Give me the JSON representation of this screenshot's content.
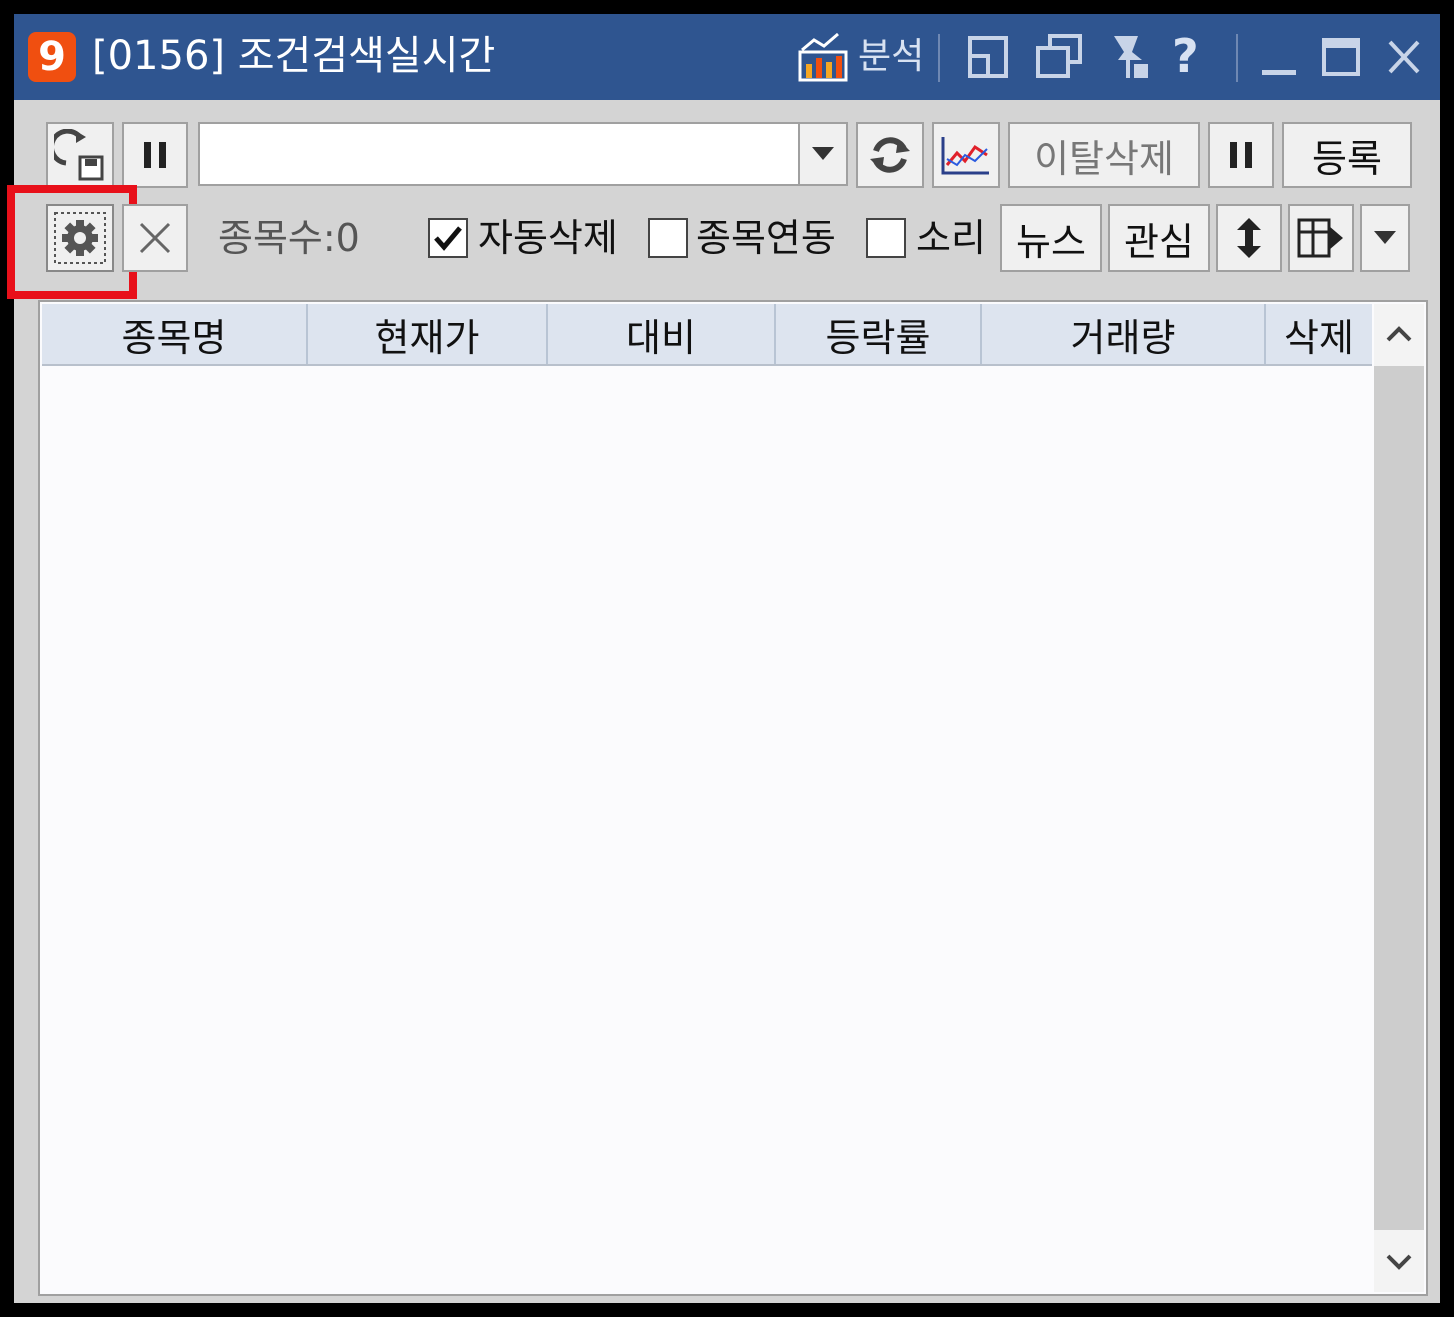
{
  "window": {
    "logo": "9",
    "title": "[0156] 조건검색실시간",
    "analysis_label": "분석",
    "help": "?",
    "icons": [
      "chart-analysis-icon",
      "restore-small-icon",
      "cascade-icon",
      "pin-icon",
      "help-icon",
      "minimize-icon",
      "maximize-icon",
      "close-icon"
    ]
  },
  "toolbar": {
    "condition_value": "",
    "exit_delete_label": "이탈삭제",
    "register_label": "등록"
  },
  "toolbar2": {
    "count_label": "종목수:0",
    "auto_delete_label": "자동삭제",
    "auto_delete_checked": true,
    "link_label": "종목연동",
    "link_checked": false,
    "sound_label": "소리",
    "sound_checked": false,
    "news_label": "뉴스",
    "watch_label": "관심"
  },
  "table": {
    "columns": [
      "종목명",
      "현재가",
      "대비",
      "등락률",
      "거래량",
      "삭제"
    ],
    "rows": []
  },
  "colors": {
    "titlebar": "#2f5590",
    "highlight": "#e8101a",
    "logo": "#f04f10"
  }
}
